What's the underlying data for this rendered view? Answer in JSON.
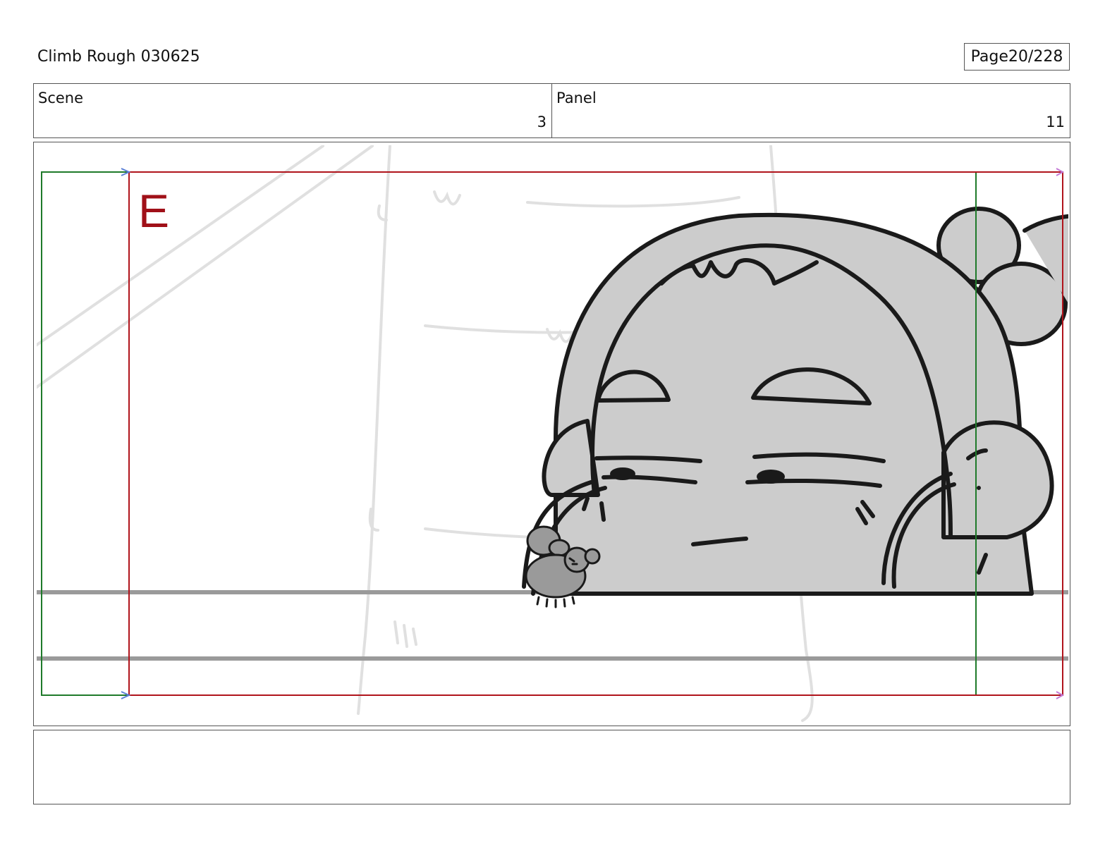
{
  "header": {
    "title": "Climb Rough 030625",
    "page_label": "Page",
    "page_number": "20/228"
  },
  "scene": {
    "label": "Scene",
    "value": "3"
  },
  "panel": {
    "label": "Panel",
    "value": "11"
  },
  "drawing": {
    "field_marker": "E",
    "colors": {
      "frame_red": "#b0141c",
      "safe_green": "#1f7a2a",
      "character_fill": "#cccccc",
      "ink": "#1a1a1a",
      "guide_gray": "#9a9a9a",
      "underlay": "#dedede"
    }
  },
  "notes": {
    "text": ""
  }
}
